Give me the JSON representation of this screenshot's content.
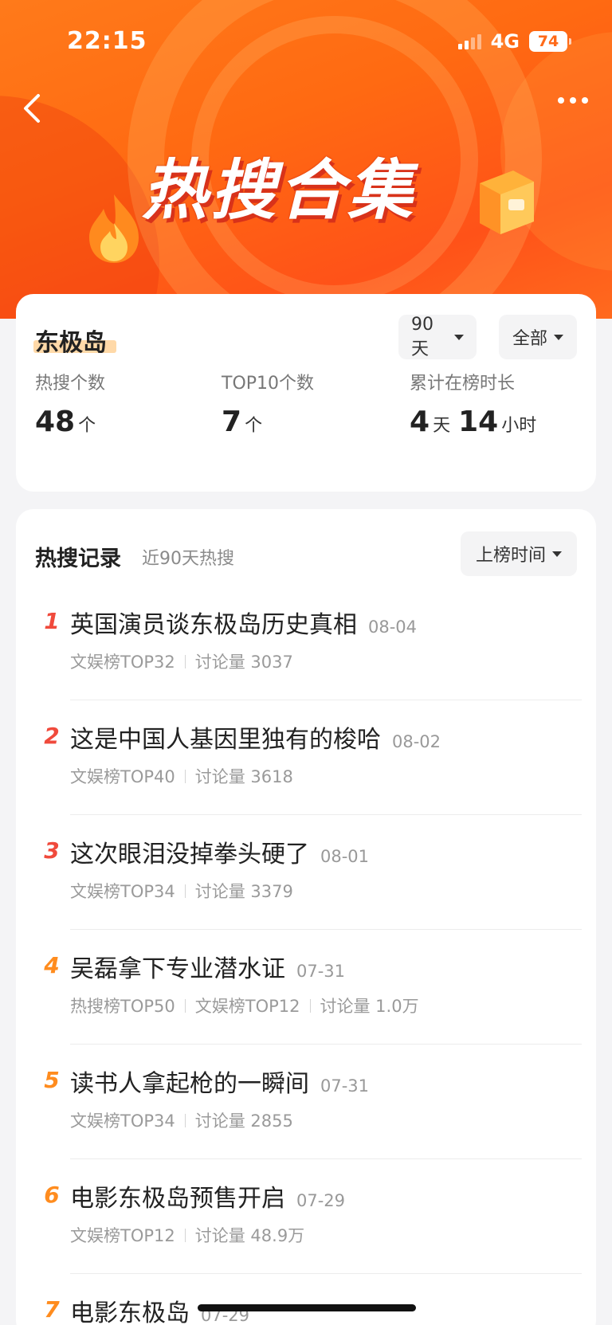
{
  "status": {
    "time": "22:15",
    "network": "4G",
    "battery": "74"
  },
  "header": {
    "banner_title": "热搜合集"
  },
  "topic": {
    "name": "东极岛",
    "filter_period": "90天",
    "filter_scope": "全部",
    "stats": [
      {
        "label": "热搜个数",
        "parts": [
          {
            "num": "48",
            "unit": "个"
          }
        ]
      },
      {
        "label": "TOP10个数",
        "parts": [
          {
            "num": "7",
            "unit": "个"
          }
        ]
      },
      {
        "label": "累计在榜时长",
        "parts": [
          {
            "num": "4",
            "unit": "天"
          },
          {
            "num": "14",
            "unit": "小时"
          }
        ]
      }
    ]
  },
  "records": {
    "title": "热搜记录",
    "subtitle": "近90天热搜",
    "sort_label": "上榜时间",
    "items": [
      {
        "rank": "1",
        "title": "英国演员谈东极岛历史真相",
        "date": "08-04",
        "meta": [
          "文娱榜TOP32",
          "讨论量 3037"
        ]
      },
      {
        "rank": "2",
        "title": "这是中国人基因里独有的梭哈",
        "date": "08-02",
        "meta": [
          "文娱榜TOP40",
          "讨论量 3618"
        ]
      },
      {
        "rank": "3",
        "title": "这次眼泪没掉拳头硬了",
        "date": "08-01",
        "meta": [
          "文娱榜TOP34",
          "讨论量 3379"
        ]
      },
      {
        "rank": "4",
        "title": "吴磊拿下专业潜水证",
        "date": "07-31",
        "meta": [
          "热搜榜TOP50",
          "文娱榜TOP12",
          "讨论量 1.0万"
        ]
      },
      {
        "rank": "5",
        "title": "读书人拿起枪的一瞬间",
        "date": "07-31",
        "meta": [
          "文娱榜TOP34",
          "讨论量 2855"
        ]
      },
      {
        "rank": "6",
        "title": "电影东极岛预售开启",
        "date": "07-29",
        "meta": [
          "文娱榜TOP12",
          "讨论量 48.9万"
        ]
      },
      {
        "rank": "7",
        "title": "电影东极岛",
        "date": "07-29",
        "meta": []
      }
    ]
  },
  "colors": {
    "accent": "#ff6a18",
    "rank_hot": "#f04a3c",
    "rank_warm": "#ff8c1e"
  }
}
